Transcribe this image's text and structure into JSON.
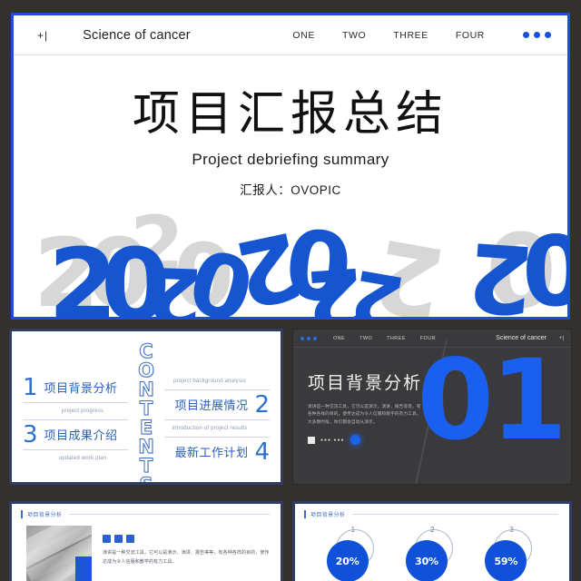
{
  "theme": {
    "accent_blue": "#1b4fd8",
    "bright_blue": "#1a5ff0",
    "grey": "#d7d7d7",
    "dark_bg": "#33312f",
    "slide_dark": "#3a3a3c"
  },
  "slide1": {
    "nav": {
      "plus_label": "+|",
      "brand": "Science of cancer",
      "menu": [
        "ONE",
        "TWO",
        "THREE",
        "FOUR"
      ],
      "dots_icon": "three-dots-icon"
    },
    "title": "项目汇报总结",
    "subtitle": "Project debriefing summary",
    "author": "汇报人：OVOPIC",
    "decor": {
      "label": "2020",
      "glyphs": [
        {
          "char": "2",
          "color": "grey",
          "left": 22,
          "top": 10,
          "size": 104,
          "rot": 0
        },
        {
          "char": "0",
          "color": "grey",
          "left": 80,
          "top": 10,
          "size": 104,
          "rot": 0
        },
        {
          "char": "2",
          "color": "grey",
          "left": 128,
          "top": -14,
          "size": 86,
          "rot": 0
        },
        {
          "char": "0",
          "color": "grey",
          "left": 176,
          "top": 16,
          "size": 96,
          "rot": 0
        },
        {
          "char": "2",
          "color": "grey",
          "left": 398,
          "top": 12,
          "size": 108,
          "rot": 190
        },
        {
          "char": "0",
          "color": "grey",
          "left": 520,
          "top": 6,
          "size": 112,
          "rot": 0
        },
        {
          "char": "2",
          "color": "blue",
          "left": 38,
          "top": 20,
          "size": 110,
          "rot": 0
        },
        {
          "char": "0",
          "color": "blue",
          "left": 96,
          "top": 20,
          "size": 110,
          "rot": 0
        },
        {
          "char": "2",
          "color": "blue",
          "left": 148,
          "top": 40,
          "size": 86,
          "rot": 182
        },
        {
          "char": "0",
          "color": "blue",
          "left": 196,
          "top": 24,
          "size": 96,
          "rot": 196
        },
        {
          "char": "2",
          "color": "blue",
          "left": 246,
          "top": 6,
          "size": 100,
          "rot": 168
        },
        {
          "char": "0",
          "color": "blue",
          "left": 300,
          "top": -2,
          "size": 104,
          "rot": 186
        },
        {
          "char": "2",
          "color": "blue",
          "left": 322,
          "top": 42,
          "size": 92,
          "rot": 176
        },
        {
          "char": "2",
          "color": "blue",
          "left": 372,
          "top": 46,
          "size": 82,
          "rot": 190
        },
        {
          "char": "2",
          "color": "blue",
          "left": 500,
          "top": 14,
          "size": 104,
          "rot": 184
        },
        {
          "char": "0",
          "color": "blue",
          "left": 560,
          "top": 8,
          "size": 106,
          "rot": 0
        }
      ]
    }
  },
  "slide2": {
    "contents_word": "CONTENTS",
    "left_items": [
      {
        "num": "1",
        "zh": "项目背景分析"
      },
      {
        "num": "3",
        "zh": "项目成果介绍"
      }
    ],
    "left_captions": [
      "project progress",
      "updated work plan"
    ],
    "right_items": [
      {
        "num": "2",
        "zh": "项目进展情况"
      },
      {
        "num": "4",
        "zh": "最新工作计划"
      }
    ],
    "right_captions": [
      "project background analysis",
      "introduction of project results"
    ]
  },
  "slide3": {
    "nav": {
      "dots_icon": "three-dots-icon",
      "menu": [
        "ONE",
        "TWO",
        "THREE",
        "FOUR"
      ],
      "brand": "Science of cancer",
      "plus_label": "+|"
    },
    "title": "项目背景分析",
    "paragraph": "演讲是一种交流工具，它可以是演示、演讲、报告等等，有各种各样的目的，使传达成为令人信服和教学的有力工具。大多数时候，你们都会自动从演示。",
    "icons": {
      "square_icon": "square-icon",
      "dot_text": "●●● ●●●",
      "circle_icon": "circle-icon"
    },
    "big_number": "01"
  },
  "slide4": {
    "section_title": "项目背景分析",
    "image_alt": "building-photo",
    "squares_icon": "three-squares-icon",
    "paragraph": "演讲是一种交流工具，它可以是演示、演讲、报告等等，有各种各样的目的，使传达成为令人信服和教学的有力工具。"
  },
  "slide5": {
    "section_title": "项目背景分析",
    "chart_data": {
      "type": "bar",
      "title": "项目背景分析",
      "categories": [
        "1",
        "2",
        "3"
      ],
      "values": [
        20,
        30,
        59
      ],
      "labels": [
        "20%",
        "30%",
        "59%"
      ],
      "xlabel": "",
      "ylabel": "",
      "ylim": [
        0,
        100
      ]
    }
  }
}
